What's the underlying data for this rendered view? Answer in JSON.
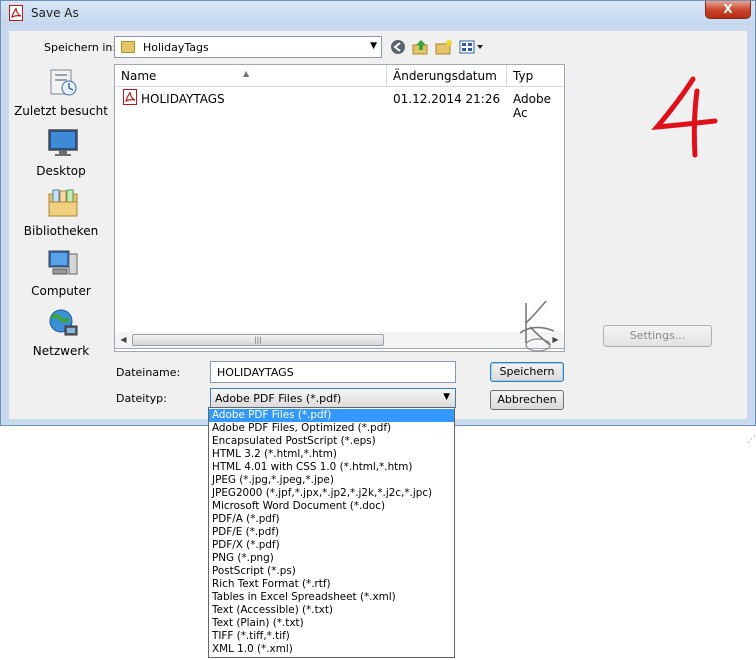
{
  "window": {
    "title": "Save As",
    "close_label": "X"
  },
  "toolbar": {
    "save_in_label": "Speichern in:",
    "save_in_value": "HolidayTags"
  },
  "places": [
    {
      "label": "Zuletzt besucht",
      "icon": "recent-places-icon"
    },
    {
      "label": "Desktop",
      "icon": "desktop-icon"
    },
    {
      "label": "Bibliotheken",
      "icon": "libraries-icon"
    },
    {
      "label": "Computer",
      "icon": "computer-icon"
    },
    {
      "label": "Netzwerk",
      "icon": "network-icon"
    }
  ],
  "file_list": {
    "columns": [
      "Name",
      "Änderungsdatum",
      "Typ"
    ],
    "rows": [
      {
        "name": "HOLIDAYTAGS",
        "date": "01.12.2014 21:26",
        "type": "Adobe Ac"
      }
    ]
  },
  "form": {
    "filename_label": "Dateiname:",
    "filename_value": "HOLIDAYTAGS",
    "filetype_label": "Dateityp:",
    "filetype_value": "Adobe PDF Files (*.pdf)"
  },
  "buttons": {
    "save": "Speichern",
    "cancel": "Abbrechen",
    "settings": "Settings..."
  },
  "filetype_options": [
    "Adobe PDF Files (*.pdf)",
    "Adobe PDF Files, Optimized (*.pdf)",
    "Encapsulated PostScript (*.eps)",
    "HTML 3.2 (*.html,*.htm)",
    "HTML 4.01 with CSS 1.0 (*.html,*.htm)",
    "JPEG (*.jpg,*.jpeg,*.jpe)",
    "JPEG2000 (*.jpf,*.jpx,*.jp2,*.j2k,*.j2c,*.jpc)",
    "Microsoft Word Document (*.doc)",
    "PDF/A (*.pdf)",
    "PDF/E (*.pdf)",
    "PDF/X (*.pdf)",
    "PNG (*.png)",
    "PostScript (*.ps)",
    "Rich Text Format (*.rtf)",
    "Tables in Excel Spreadsheet (*.xml)",
    "Text (Accessible) (*.txt)",
    "Text (Plain) (*.txt)",
    "TIFF (*.tiff,*.tif)",
    "XML 1.0 (*.xml)"
  ],
  "selected_option_index": 0,
  "annotation": {
    "step_number": "4"
  },
  "colors": {
    "selection": "#3399ff",
    "annotation": "#e0101a",
    "dialog_frame": "#c9daee"
  }
}
